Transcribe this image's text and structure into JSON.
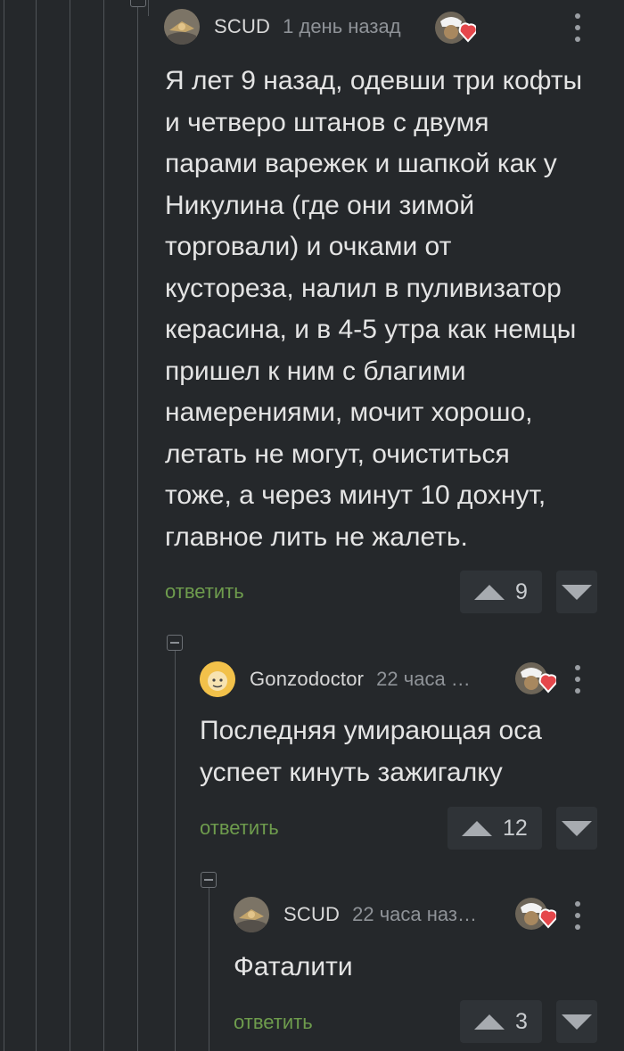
{
  "comments": [
    {
      "author": "SCUD",
      "time": "1 день назад",
      "text_lines": [
        "Я лет 9 назад, одевши три кофты",
        "и четверо штанов с двумя",
        "парами варежек и шапкой как у",
        "Никулина (где они зимой",
        "торговали) и очками от",
        "кустореза, налил в пуливизатор",
        "керасина, и в 4-5 утра как немцы",
        "пришел к ним с благими",
        "намерениями, мочит хорошо,",
        "летать не могут, очиститься",
        "тоже, а через минут 10 дохнут,",
        "главное лить не жалеть."
      ],
      "reply_label": "ответить",
      "rating": "9"
    },
    {
      "author": "Gonzodoctor",
      "time": "22 часа …",
      "text_lines": [
        "Последняя умирающая оса",
        "успеет кинуть зажигалку"
      ],
      "reply_label": "ответить",
      "rating": "12"
    },
    {
      "author": "SCUD",
      "time": "22 часа наз…",
      "text_lines": [
        "Фаталити"
      ],
      "reply_label": "ответить",
      "rating": "3"
    }
  ],
  "colors": {
    "background": "#25282b",
    "reply_link": "#6e9c4d",
    "badge_heart": "#e5474b",
    "guide_line": "#505458"
  },
  "icons": [
    "avatar-image",
    "award-heart-badge",
    "kebab-menu-icon",
    "upvote-arrow-icon",
    "downvote-arrow-icon",
    "collapse-thread-icon"
  ]
}
